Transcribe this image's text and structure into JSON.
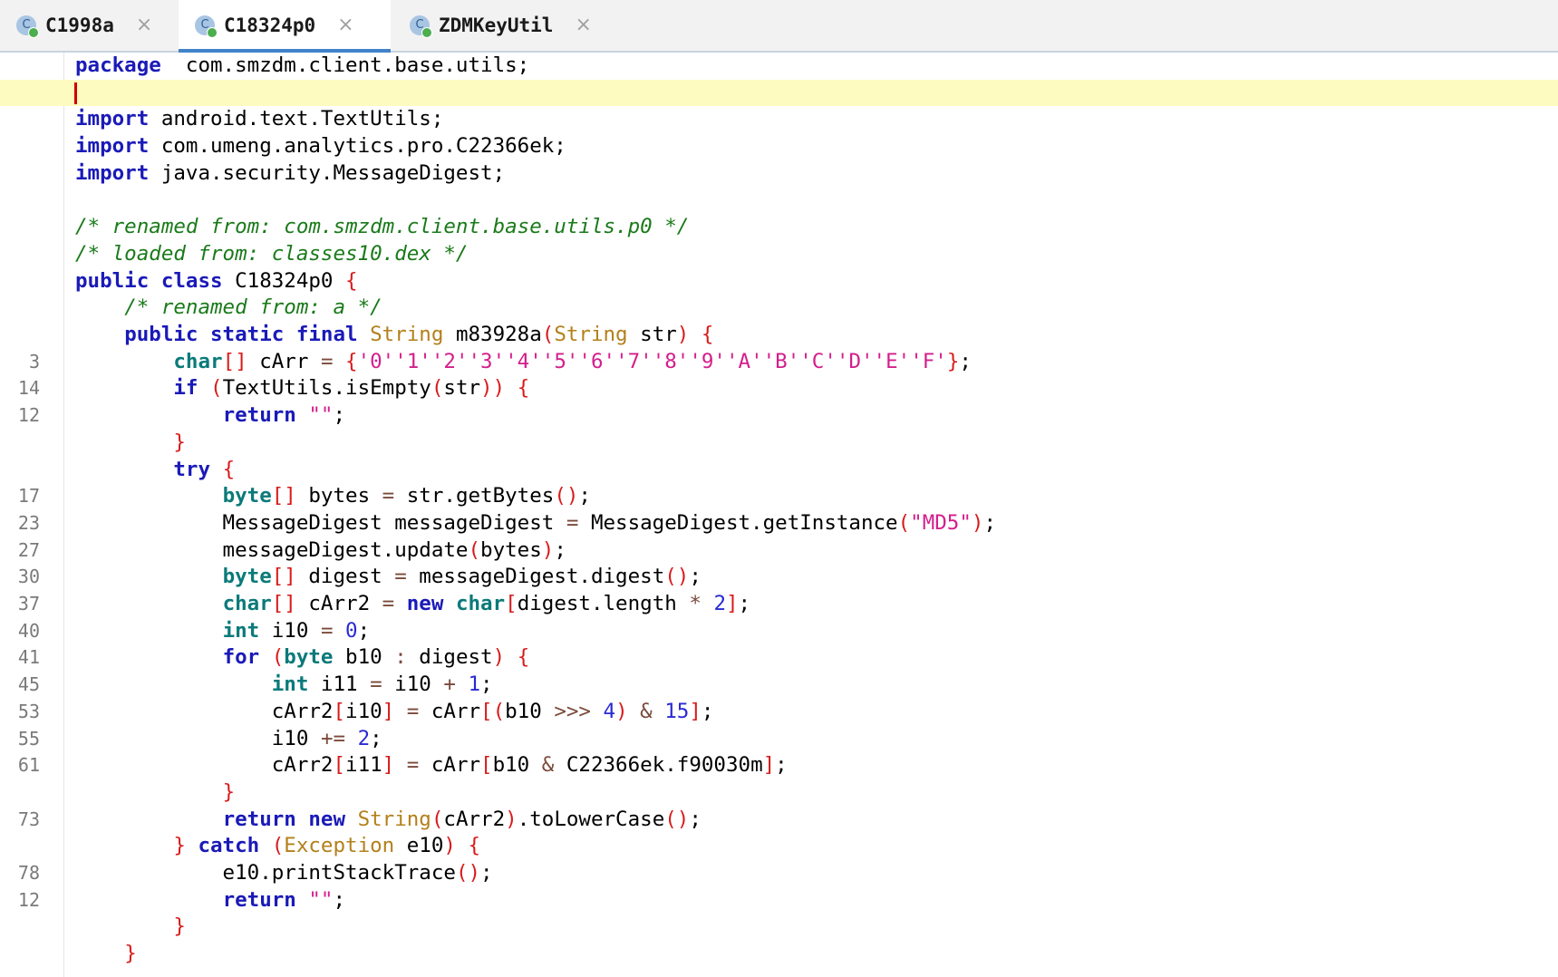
{
  "tabs": [
    {
      "label": "C1998a",
      "icon": "class-icon",
      "icon_letter": "C",
      "active": false
    },
    {
      "label": "C18324p0",
      "icon": "class-icon",
      "icon_letter": "C",
      "active": true
    },
    {
      "label": "ZDMKeyUtil",
      "icon": "class-icon",
      "icon_letter": "C",
      "active": false
    }
  ],
  "tab_close_glyph": "×",
  "colors": {
    "keyword": "#1a1ab8",
    "type": "#0b7a7a",
    "comment": "#1a7a1a",
    "string": "#d41e8c",
    "number": "#2a2ad4",
    "bracket": "#d81b1b",
    "current_line": "#fdfbc0",
    "active_tab_underline": "#4083c9"
  },
  "editor": {
    "current_line": 1,
    "lines": [
      {
        "n": "",
        "tokens": [
          [
            "kw",
            "package"
          ],
          [
            "",
            "  com.smzdm.client.base.utils;"
          ]
        ]
      },
      {
        "n": "",
        "tokens": []
      },
      {
        "n": "",
        "tokens": [
          [
            "kw",
            "import"
          ],
          [
            "",
            " android.text.TextUtils;"
          ]
        ]
      },
      {
        "n": "",
        "tokens": [
          [
            "kw",
            "import"
          ],
          [
            "",
            " com.umeng.analytics.pro.C22366ek;"
          ]
        ]
      },
      {
        "n": "",
        "tokens": [
          [
            "kw",
            "import"
          ],
          [
            "",
            " java.security.MessageDigest;"
          ]
        ]
      },
      {
        "n": "",
        "tokens": []
      },
      {
        "n": "",
        "tokens": [
          [
            "cm",
            "/* renamed from: com.smzdm.client.base.utils.p0 */"
          ]
        ]
      },
      {
        "n": "",
        "tokens": [
          [
            "cm",
            "/* loaded from: classes10.dex */"
          ]
        ]
      },
      {
        "n": "",
        "tokens": [
          [
            "kw",
            "public"
          ],
          [
            "",
            " "
          ],
          [
            "kw",
            "class"
          ],
          [
            "",
            " C18324p0 "
          ],
          [
            "br",
            "{"
          ]
        ]
      },
      {
        "n": "",
        "tokens": [
          [
            "",
            "    "
          ],
          [
            "cm",
            "/* renamed from: a */"
          ]
        ]
      },
      {
        "n": "",
        "tokens": [
          [
            "",
            "    "
          ],
          [
            "kw",
            "public"
          ],
          [
            "",
            " "
          ],
          [
            "kw",
            "static"
          ],
          [
            "",
            " "
          ],
          [
            "kw",
            "final"
          ],
          [
            "",
            " "
          ],
          [
            "ty2",
            "String"
          ],
          [
            "",
            " m83928a"
          ],
          [
            "br",
            "("
          ],
          [
            "ty2",
            "String"
          ],
          [
            "",
            " str"
          ],
          [
            "br",
            ")"
          ],
          [
            "",
            " "
          ],
          [
            "br",
            "{"
          ]
        ]
      },
      {
        "n": "3",
        "tokens": [
          [
            "",
            "        "
          ],
          [
            "ty",
            "char"
          ],
          [
            "br",
            "[]"
          ],
          [
            "",
            " cArr "
          ],
          [
            "op",
            "="
          ],
          [
            "",
            " "
          ],
          [
            "br",
            "{"
          ],
          [
            "st",
            "'0'"
          ],
          [
            ", "
          ],
          [
            "st",
            "'1'"
          ],
          [
            ", "
          ],
          [
            "st",
            "'2'"
          ],
          [
            ", "
          ],
          [
            "st",
            "'3'"
          ],
          [
            ", "
          ],
          [
            "st",
            "'4'"
          ],
          [
            ", "
          ],
          [
            "st",
            "'5'"
          ],
          [
            ", "
          ],
          [
            "st",
            "'6'"
          ],
          [
            ", "
          ],
          [
            "st",
            "'7'"
          ],
          [
            ", "
          ],
          [
            "st",
            "'8'"
          ],
          [
            ", "
          ],
          [
            "st",
            "'9'"
          ],
          [
            ", "
          ],
          [
            "st",
            "'A'"
          ],
          [
            ", "
          ],
          [
            "st",
            "'B'"
          ],
          [
            ", "
          ],
          [
            "st",
            "'C'"
          ],
          [
            ", "
          ],
          [
            "st",
            "'D'"
          ],
          [
            ", "
          ],
          [
            "st",
            "'E'"
          ],
          [
            ", "
          ],
          [
            "st",
            "'F'"
          ],
          [
            "br",
            "}"
          ],
          [
            "",
            ";"
          ]
        ]
      },
      {
        "n": "14",
        "tokens": [
          [
            "",
            "        "
          ],
          [
            "kw",
            "if"
          ],
          [
            "",
            " "
          ],
          [
            "br",
            "("
          ],
          [
            "",
            "TextUtils.isEmpty"
          ],
          [
            "br",
            "("
          ],
          [
            "",
            "str"
          ],
          [
            "br",
            "))"
          ],
          [
            "",
            " "
          ],
          [
            "br",
            "{"
          ]
        ]
      },
      {
        "n": "12",
        "tokens": [
          [
            "",
            "            "
          ],
          [
            "kw",
            "return"
          ],
          [
            "",
            " "
          ],
          [
            "st",
            "\"\""
          ],
          [
            "",
            ";"
          ]
        ]
      },
      {
        "n": "",
        "tokens": [
          [
            "",
            "        "
          ],
          [
            "br",
            "}"
          ]
        ]
      },
      {
        "n": "",
        "tokens": [
          [
            "",
            "        "
          ],
          [
            "kw",
            "try"
          ],
          [
            "",
            " "
          ],
          [
            "br",
            "{"
          ]
        ]
      },
      {
        "n": "17",
        "tokens": [
          [
            "",
            "            "
          ],
          [
            "ty",
            "byte"
          ],
          [
            "br",
            "[]"
          ],
          [
            "",
            " bytes "
          ],
          [
            "op",
            "="
          ],
          [
            "",
            " str.getBytes"
          ],
          [
            "br",
            "()"
          ],
          [
            "",
            ";"
          ]
        ]
      },
      {
        "n": "23",
        "tokens": [
          [
            "",
            "            MessageDigest messageDigest "
          ],
          [
            "op",
            "="
          ],
          [
            "",
            " MessageDigest.getInstance"
          ],
          [
            "br",
            "("
          ],
          [
            "st",
            "\"MD5\""
          ],
          [
            "br",
            ")"
          ],
          [
            "",
            ";"
          ]
        ]
      },
      {
        "n": "27",
        "tokens": [
          [
            "",
            "            messageDigest.update"
          ],
          [
            "br",
            "("
          ],
          [
            "",
            "bytes"
          ],
          [
            "br",
            ")"
          ],
          [
            "",
            ";"
          ]
        ]
      },
      {
        "n": "30",
        "tokens": [
          [
            "",
            "            "
          ],
          [
            "ty",
            "byte"
          ],
          [
            "br",
            "[]"
          ],
          [
            "",
            " digest "
          ],
          [
            "op",
            "="
          ],
          [
            "",
            " messageDigest.digest"
          ],
          [
            "br",
            "()"
          ],
          [
            "",
            ";"
          ]
        ]
      },
      {
        "n": "37",
        "tokens": [
          [
            "",
            "            "
          ],
          [
            "ty",
            "char"
          ],
          [
            "br",
            "[]"
          ],
          [
            "",
            " cArr2 "
          ],
          [
            "op",
            "="
          ],
          [
            "",
            " "
          ],
          [
            "kw",
            "new"
          ],
          [
            "",
            " "
          ],
          [
            "ty",
            "char"
          ],
          [
            "br",
            "["
          ],
          [
            "",
            "digest.length "
          ],
          [
            "op",
            "*"
          ],
          [
            "",
            " "
          ],
          [
            "nm",
            "2"
          ],
          [
            "br",
            "]"
          ],
          [
            "",
            ";"
          ]
        ]
      },
      {
        "n": "40",
        "tokens": [
          [
            "",
            "            "
          ],
          [
            "ty",
            "int"
          ],
          [
            "",
            " i10 "
          ],
          [
            "op",
            "="
          ],
          [
            "",
            " "
          ],
          [
            "nm",
            "0"
          ],
          [
            "",
            ";"
          ]
        ]
      },
      {
        "n": "41",
        "tokens": [
          [
            "",
            "            "
          ],
          [
            "kw",
            "for"
          ],
          [
            "",
            " "
          ],
          [
            "br",
            "("
          ],
          [
            "ty",
            "byte"
          ],
          [
            "",
            " b10 "
          ],
          [
            "op",
            ":"
          ],
          [
            "",
            " digest"
          ],
          [
            "br",
            ")"
          ],
          [
            "",
            " "
          ],
          [
            "br",
            "{"
          ]
        ]
      },
      {
        "n": "45",
        "tokens": [
          [
            "",
            "                "
          ],
          [
            "ty",
            "int"
          ],
          [
            "",
            " i11 "
          ],
          [
            "op",
            "="
          ],
          [
            "",
            " i10 "
          ],
          [
            "op",
            "+"
          ],
          [
            "",
            " "
          ],
          [
            "nm",
            "1"
          ],
          [
            "",
            ";"
          ]
        ]
      },
      {
        "n": "53",
        "tokens": [
          [
            "",
            "                cArr2"
          ],
          [
            "br",
            "["
          ],
          [
            "",
            "i10"
          ],
          [
            "br",
            "]"
          ],
          [
            "",
            " "
          ],
          [
            "op",
            "="
          ],
          [
            "",
            " cArr"
          ],
          [
            "br",
            "[("
          ],
          [
            "",
            "b10 "
          ],
          [
            "op",
            ">>>"
          ],
          [
            "",
            " "
          ],
          [
            "nm",
            "4"
          ],
          [
            "br",
            ")"
          ],
          [
            "",
            " "
          ],
          [
            "op",
            "&"
          ],
          [
            "",
            " "
          ],
          [
            "nm",
            "15"
          ],
          [
            "br",
            "]"
          ],
          [
            "",
            ";"
          ]
        ]
      },
      {
        "n": "55",
        "tokens": [
          [
            "",
            "                i10 "
          ],
          [
            "op",
            "+="
          ],
          [
            "",
            " "
          ],
          [
            "nm",
            "2"
          ],
          [
            "",
            ";"
          ]
        ]
      },
      {
        "n": "61",
        "tokens": [
          [
            "",
            "                cArr2"
          ],
          [
            "br",
            "["
          ],
          [
            "",
            "i11"
          ],
          [
            "br",
            "]"
          ],
          [
            "",
            " "
          ],
          [
            "op",
            "="
          ],
          [
            "",
            " cArr"
          ],
          [
            "br",
            "["
          ],
          [
            "",
            "b10 "
          ],
          [
            "op",
            "&"
          ],
          [
            "",
            " C22366ek.f90030m"
          ],
          [
            "br",
            "]"
          ],
          [
            "",
            ";"
          ]
        ]
      },
      {
        "n": "",
        "tokens": [
          [
            "",
            "            "
          ],
          [
            "br",
            "}"
          ]
        ]
      },
      {
        "n": "73",
        "tokens": [
          [
            "",
            "            "
          ],
          [
            "kw",
            "return"
          ],
          [
            "",
            " "
          ],
          [
            "kw",
            "new"
          ],
          [
            "",
            " "
          ],
          [
            "ty2",
            "String"
          ],
          [
            "br",
            "("
          ],
          [
            "",
            "cArr2"
          ],
          [
            "br",
            ")"
          ],
          [
            "",
            ".toLowerCase"
          ],
          [
            "br",
            "()"
          ],
          [
            "",
            ";"
          ]
        ]
      },
      {
        "n": "",
        "tokens": [
          [
            "",
            "        "
          ],
          [
            "br",
            "}"
          ],
          [
            "",
            " "
          ],
          [
            "kw",
            "catch"
          ],
          [
            "",
            " "
          ],
          [
            "br",
            "("
          ],
          [
            "ty2",
            "Exception"
          ],
          [
            "",
            " e10"
          ],
          [
            "br",
            ")"
          ],
          [
            "",
            " "
          ],
          [
            "br",
            "{"
          ]
        ]
      },
      {
        "n": "78",
        "tokens": [
          [
            "",
            "            e10.printStackTrace"
          ],
          [
            "br",
            "()"
          ],
          [
            "",
            ";"
          ]
        ]
      },
      {
        "n": "12",
        "tokens": [
          [
            "",
            "            "
          ],
          [
            "kw",
            "return"
          ],
          [
            "",
            " "
          ],
          [
            "st",
            "\"\""
          ],
          [
            "",
            ";"
          ]
        ]
      },
      {
        "n": "",
        "tokens": [
          [
            "",
            "        "
          ],
          [
            "br",
            "}"
          ]
        ]
      },
      {
        "n": "",
        "tokens": [
          [
            "",
            "    "
          ],
          [
            "br",
            "}"
          ]
        ]
      }
    ]
  }
}
